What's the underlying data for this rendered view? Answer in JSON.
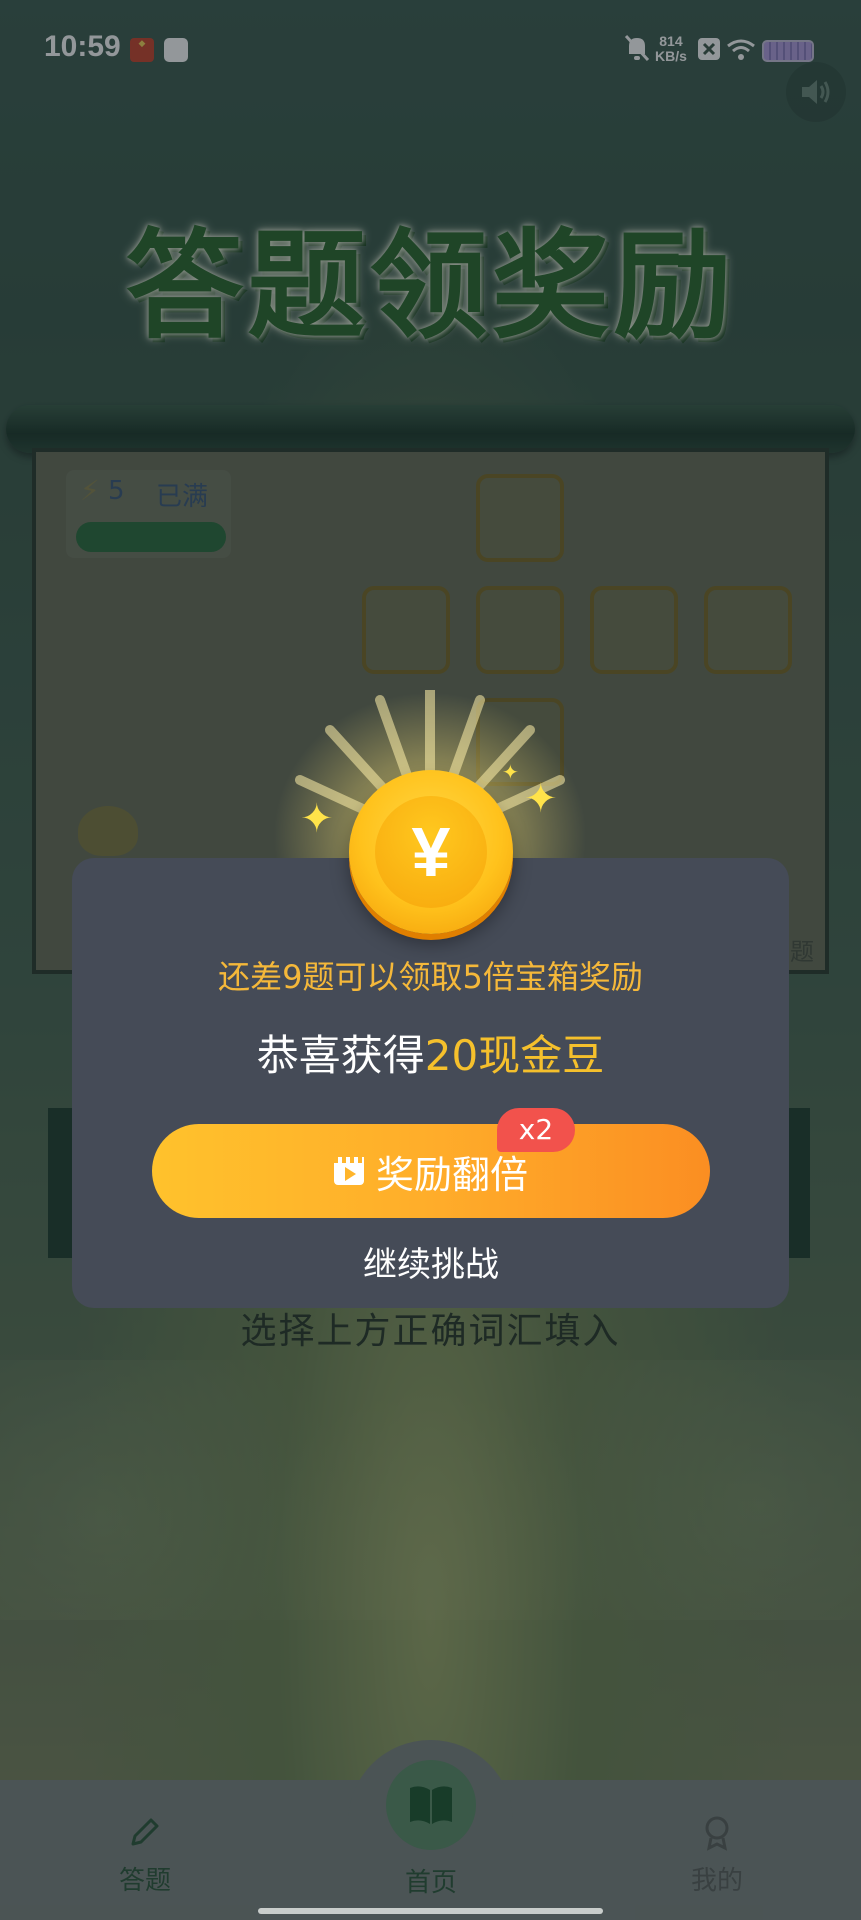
{
  "status_bar": {
    "time": "10:59",
    "net_speed_value": "814",
    "net_speed_unit": "KB/s",
    "icons": [
      "app-icon",
      "mail-icon",
      "mute-bell-icon",
      "x-icon",
      "wifi-icon",
      "battery-icon"
    ]
  },
  "game": {
    "title": "答题领奖励",
    "energy_count": "5",
    "energy_status": "已满",
    "corner_text": "题",
    "hint": "选择上方正确词汇填入"
  },
  "dialog": {
    "remain_text": "还差9题可以领取5倍宝箱奖励",
    "congrats_prefix": "恭喜获得",
    "congrats_amount": "20现金豆",
    "coin_symbol": "¥",
    "double_button_label": "奖励翻倍",
    "multiplier_badge": "x2",
    "continue_label": "继续挑战",
    "colors": {
      "accent_orange": "#f5b83a",
      "button_start": "#ffc22c",
      "button_end": "#fb8e22",
      "badge_red": "#f2524c",
      "dialog_bg": "#454b57"
    }
  },
  "bottom_nav": {
    "items": [
      {
        "label": "答题",
        "icon": "pencil-icon"
      },
      {
        "label": "首页",
        "icon": "book-icon"
      },
      {
        "label": "我的",
        "icon": "profile-icon"
      }
    ]
  }
}
